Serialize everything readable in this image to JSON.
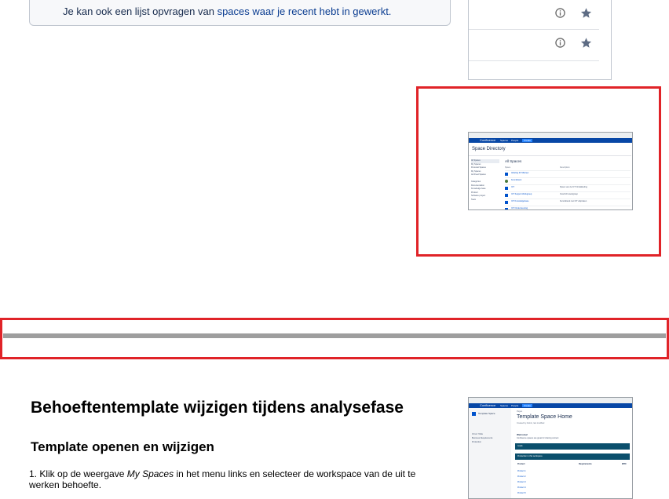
{
  "info_box": {
    "text_before": "Je kan ook een lijst opvragen van ",
    "link_text": "spaces waar je recent hebt in gewerkt."
  },
  "list_panel": {
    "rows": [
      {
        "info_icon": "info-icon",
        "star_icon": "star-icon"
      },
      {
        "info_icon": "info-icon",
        "star_icon": "star-icon"
      }
    ]
  },
  "space_directory_thumb": {
    "app_name": "Confluence",
    "nav_spaces": "Spaces",
    "nav_people": "People",
    "nav_create": "Create",
    "title": "Space Directory",
    "section_title": "All Spaces",
    "column_name": "Space",
    "column_description": "Description",
    "sidebar_items": [
      "All Spaces",
      "My Spaces",
      "Personal Spaces",
      "My Spaces",
      "Archived Spaces",
      "",
      "Categories",
      "Documentation",
      "Knowledge base",
      "Product",
      "Software project",
      "Team"
    ],
    "rows": [
      {
        "name": "Afdeling ICT-Beheer",
        "description": ""
      },
      {
        "name": "Kennisbank",
        "description": ""
      },
      {
        "name": "ICT",
        "description": "Space van de ICT Ontwikkeling"
      },
      {
        "name": "ICT Support Werkgroep",
        "description": "Overzicht werkgroep"
      },
      {
        "name": "ICT Knowledgebase",
        "description": "Kennisbank met ICT afspraken"
      },
      {
        "name": "ICT Ondersteuning",
        "description": ""
      }
    ]
  },
  "heading_main": "Behoeftentemplate wijzigen tijdens analysefase",
  "heading_sub": "Template openen en wijzigen",
  "step1": {
    "prefix": "1. Klik op de weergave ",
    "emphasis": "My Spaces",
    "suffix": " in het menu links en selecteer de workspace van de uit te werken behoefte."
  },
  "template_thumb": {
    "app_name": "Confluence",
    "nav_spaces": "Spaces",
    "nav_people": "People",
    "nav_create": "Create",
    "sidebar_title": "Template Space",
    "breadcrumb": "Pages",
    "title": "Template Space Home",
    "subtitle": "Created by Admin, last modified",
    "welcome": "Welcome!",
    "welcome_sub": "Confluence spaces are great for sharing content",
    "section1": "Goals",
    "section2": "Production in this workspace",
    "col1": "Product",
    "col2": "Requirements",
    "col3": "EPIC",
    "products": [
      "Product 1",
      "Product 2",
      "Product 3",
      "Product 4",
      "Product 5"
    ],
    "sidebar_links": [
      "PAGE TREE",
      "Business Requirements",
      "Production"
    ]
  },
  "colors": {
    "red_frame": "#e02328",
    "confluence_blue": "#0747a6",
    "link": "#0b3d91",
    "separator": "#9e9e9e"
  }
}
